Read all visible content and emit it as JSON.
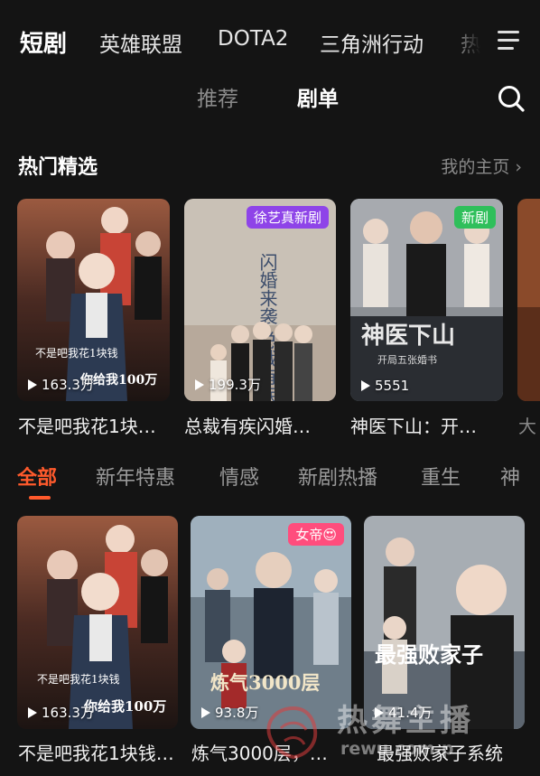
{
  "top_tabs": [
    "短剧",
    "英雄联盟",
    "DOTA2",
    "三角洲行动",
    "热"
  ],
  "sub_tabs": [
    "推荐",
    "剧单"
  ],
  "section": {
    "title": "热门精选",
    "more": "我的主页"
  },
  "featured": [
    {
      "plays": "163.3万",
      "title": "不是吧我花1块…",
      "poster_text_a": "不是吧我花1块钱",
      "poster_text_b": "你给我100万"
    },
    {
      "plays": "199.3万",
      "title": "总裁有疾闪婚…",
      "badge": "徐艺真新剧",
      "poster_text": "闪婚来袭 总裁有疾"
    },
    {
      "plays": "5551",
      "title": "神医下山：开…",
      "badge": "新剧",
      "poster_text": "神医下山",
      "poster_sub": "开局五张婚书"
    },
    {
      "plays": "",
      "title": "大"
    }
  ],
  "categories": [
    "全部",
    "新年特惠",
    "情感",
    "新剧热播",
    "重生",
    "神"
  ],
  "grid": [
    {
      "plays": "163.3万",
      "title": "不是吧我花1块钱…",
      "poster_text_a": "不是吧我花1块钱",
      "poster_text_b": "你给我100万"
    },
    {
      "plays": "93.8万",
      "title": "炼气3000层，…",
      "badge": "女帝😍",
      "poster_text": "炼气3000层"
    },
    {
      "plays": "41.4万",
      "title": "最强败家子系统",
      "poster_text": "最强败家子"
    }
  ],
  "watermark": {
    "main": "热舞主播",
    "sub": "rewu.com.p"
  },
  "colors": {
    "accent": "#ff5a2c",
    "badge_purple": "#8e44e8",
    "badge_green": "#2fbf5b",
    "badge_pink": "#ff4d7d"
  }
}
